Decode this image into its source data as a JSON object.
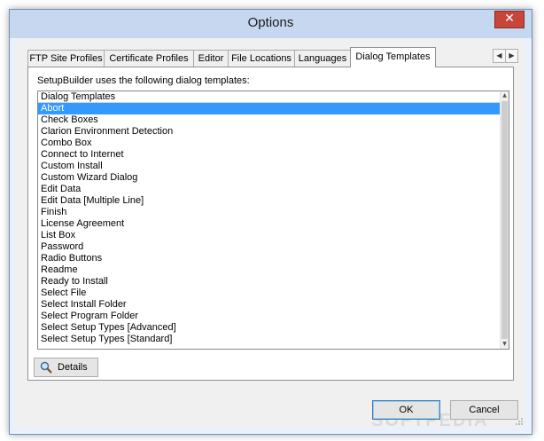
{
  "window": {
    "title": "Options",
    "close_glyph": "✕"
  },
  "tabs": [
    {
      "label": "FTP Site Profiles",
      "active": false
    },
    {
      "label": "Certificate Profiles",
      "active": false
    },
    {
      "label": "Editor",
      "active": false
    },
    {
      "label": "File Locations",
      "active": false
    },
    {
      "label": "Languages",
      "active": false
    },
    {
      "label": "Dialog Templates",
      "active": true
    }
  ],
  "tab_scroll": {
    "left_glyph": "◀",
    "right_glyph": "▶"
  },
  "panel": {
    "prompt": "SetupBuilder uses the following dialog templates:",
    "list_header": "Dialog Templates",
    "items": [
      "Abort",
      "Check Boxes",
      "Clarion Environment Detection",
      "Combo Box",
      "Connect to Internet",
      "Custom Install",
      "Custom Wizard Dialog",
      "Edit Data",
      "Edit Data [Multiple Line]",
      "Finish",
      "License Agreement",
      "List Box",
      "Password",
      "Radio Buttons",
      "Readme",
      "Ready to Install",
      "Select File",
      "Select Install Folder",
      "Select Program Folder",
      "Select Setup Types [Advanced]",
      "Select Setup Types [Standard]"
    ],
    "selected_index": 0,
    "scroll_up_glyph": "▲",
    "scroll_down_glyph": "▼",
    "details_label": "Details"
  },
  "buttons": {
    "ok_label": "OK",
    "cancel_label": "Cancel"
  },
  "watermark": "SOFTPEDIA",
  "colors": {
    "selection": "#3399ff",
    "close_button": "#c7463c",
    "window_frame": "#c6d8ef"
  }
}
